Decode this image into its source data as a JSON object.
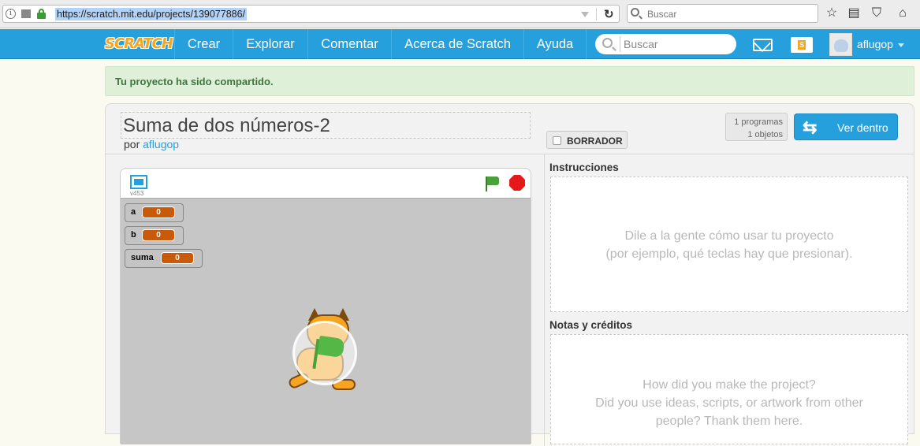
{
  "browser": {
    "url": "https://scratch.mit.edu/projects/139077886/",
    "search_placeholder": "Buscar"
  },
  "nav": {
    "logo": "SCRATCH",
    "items": [
      "Crear",
      "Explorar",
      "Comentar",
      "Acerca de Scratch",
      "Ayuda"
    ],
    "search_placeholder": "Buscar",
    "username": "aflugop",
    "folder_letter": "S"
  },
  "notice": {
    "text": "Tu proyecto ha sido compartido."
  },
  "project": {
    "title": "Suma de dos números-2",
    "by_prefix": "por",
    "author": "aflugop",
    "draft_label": "BORRADOR",
    "stats_scripts": "1 programas",
    "stats_sprites": "1 objetos",
    "see_inside": "Ver dentro"
  },
  "player": {
    "version": "v453",
    "monitors": [
      {
        "name": "a",
        "value": "0"
      },
      {
        "name": "b",
        "value": "0"
      },
      {
        "name": "suma",
        "value": "0"
      }
    ]
  },
  "instructions": {
    "title": "Instrucciones",
    "hint_line1": "Dile a la gente cómo usar tu proyecto",
    "hint_line2": "(por ejemplo, qué teclas hay que presionar)."
  },
  "notes": {
    "title": "Notas y créditos",
    "hint_line1": "How did you make the project?",
    "hint_line2": "Did you use ideas, scripts, or artwork from other",
    "hint_line3": "people? Thank them here."
  }
}
